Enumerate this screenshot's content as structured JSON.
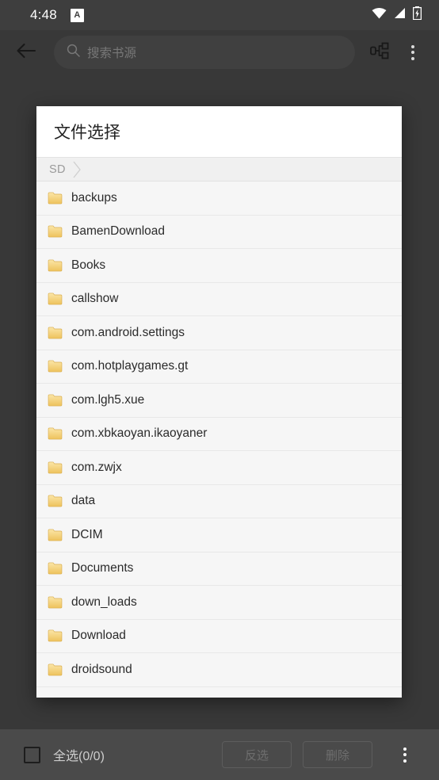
{
  "status_bar": {
    "time": "4:48",
    "notification_badge": "A",
    "icons": [
      "wifi-icon",
      "cellular-signal-icon",
      "battery-charging-icon"
    ]
  },
  "app_bar": {
    "back_icon": "arrow-left-icon",
    "search": {
      "placeholder": "搜索书源",
      "value": "",
      "icon": "search-icon"
    },
    "tree_icon": "hierarchy-tree-icon",
    "overflow_icon": "more-vertical-icon"
  },
  "dialog": {
    "title": "文件选择",
    "breadcrumb": [
      {
        "label": "SD"
      }
    ],
    "files": [
      {
        "name": "backups",
        "type": "folder"
      },
      {
        "name": "BamenDownload",
        "type": "folder"
      },
      {
        "name": "Books",
        "type": "folder"
      },
      {
        "name": "callshow",
        "type": "folder"
      },
      {
        "name": "com.android.settings",
        "type": "folder"
      },
      {
        "name": "com.hotplaygames.gt",
        "type": "folder"
      },
      {
        "name": "com.lgh5.xue",
        "type": "folder"
      },
      {
        "name": "com.xbkaoyan.ikaoyaner",
        "type": "folder"
      },
      {
        "name": "com.zwjx",
        "type": "folder"
      },
      {
        "name": "data",
        "type": "folder"
      },
      {
        "name": "DCIM",
        "type": "folder"
      },
      {
        "name": "Documents",
        "type": "folder"
      },
      {
        "name": "down_loads",
        "type": "folder"
      },
      {
        "name": "Download",
        "type": "folder"
      },
      {
        "name": "droidsound",
        "type": "folder"
      }
    ]
  },
  "bottom_bar": {
    "select_all_label": "全选(0/0)",
    "select_all_checked": false,
    "invert_label": "反选",
    "delete_label": "删除",
    "overflow_icon": "more-vertical-icon"
  },
  "colors": {
    "scaffold_background": "#424242",
    "status_bar_background": "#3e3e3e",
    "bottom_bar_background": "#4a4a4a",
    "dialog_background": "#ffffff",
    "list_background": "#f6f6f6",
    "breadcrumb_background": "#f0f0f0",
    "folder_icon": "#f2ce73",
    "primary_text": "#2b2b2b",
    "muted_text": "#9a9a9a",
    "disabled_button_text": "#6e6e6e"
  }
}
